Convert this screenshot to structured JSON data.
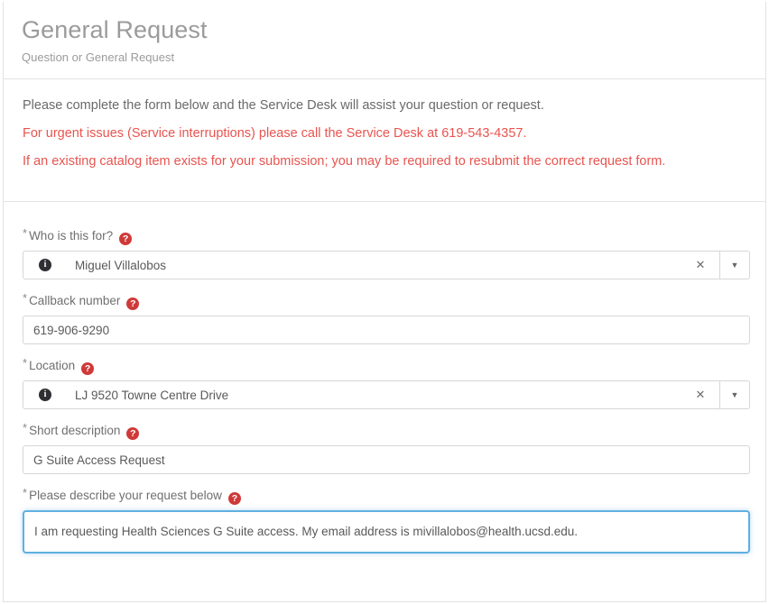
{
  "header": {
    "title": "General Request",
    "subtitle": "Question or General Request"
  },
  "instructions": {
    "line1": "Please complete the form below and the Service Desk will assist your question or request.",
    "line2": "For urgent issues (Service interruptions) please call the Service Desk at 619-543-4357.",
    "line3": "If an existing catalog item exists for your submission; you may be required to resubmit the correct request form."
  },
  "icons": {
    "help": "?",
    "info": "i",
    "clear": "✕",
    "caret": "▼"
  },
  "colors": {
    "alert_red": "#e8544f",
    "help_icon_red": "#cf3a38",
    "focus_blue": "#5fb0e0",
    "label_gray": "#6f6f6f",
    "title_gray": "#9b9b9b"
  },
  "fields": {
    "who_is_this_for": {
      "label": "Who is this for?",
      "required": true,
      "value": "Miguel Villalobos",
      "type": "reference",
      "has_clear": true,
      "has_dropdown": true
    },
    "callback_number": {
      "label": "Callback number",
      "required": true,
      "value": "619-906-9290",
      "placeholder": "",
      "type": "text"
    },
    "location": {
      "label": "Location",
      "required": true,
      "value": "LJ 9520 Towne Centre Drive",
      "type": "reference",
      "has_clear": true,
      "has_dropdown": true
    },
    "short_description": {
      "label": "Short description",
      "required": true,
      "value": "G Suite Access Request",
      "placeholder": "",
      "type": "text"
    },
    "describe_request": {
      "label": "Please describe your request below",
      "required": true,
      "value": "I am requesting Health Sciences G Suite access. My email address is mivillalobos@health.ucsd.edu.",
      "placeholder": "",
      "type": "textarea",
      "focused": true
    }
  },
  "required_marker": "*"
}
